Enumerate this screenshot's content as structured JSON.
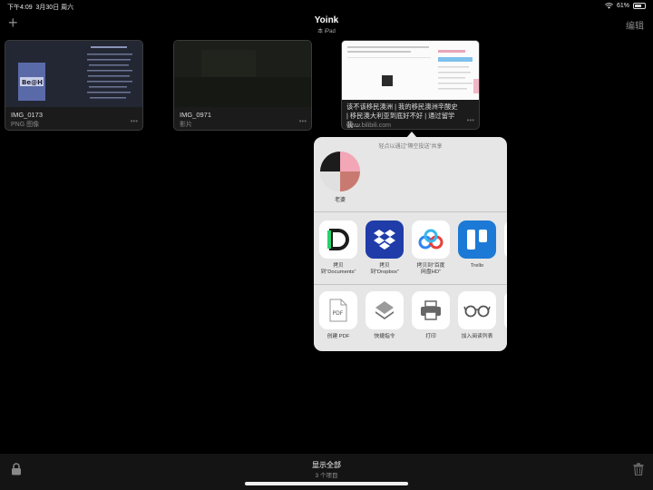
{
  "status_bar": {
    "time": "下午4:09",
    "date": "3月30日 周六",
    "battery": "61%",
    "battery_level": 0.61
  },
  "nav": {
    "title": "Yoink",
    "subtitle": "本 iPad",
    "edit": "编辑"
  },
  "cards": [
    {
      "name": "IMG_0173",
      "kind": "PNG 图像"
    },
    {
      "name": "IMG_0971",
      "kind": "影片"
    },
    {
      "title": "该不该移民澳洲 | 我的移民澳洲辛酸史 | 移民澳大利亚到底好不好 | 通过留学我...",
      "url": "www.bilibili.com"
    }
  ],
  "share": {
    "hint": "轻点以通过“隔空投送”共享",
    "contact": {
      "name": "老婆"
    },
    "apps": [
      {
        "label": "拷贝\n到“Documents”",
        "icon": "documents-icon",
        "color": "#2ad06b"
      },
      {
        "label": "拷贝\n到“Dropbox”",
        "icon": "dropbox-icon",
        "color": "#1f3ca8"
      },
      {
        "label": "拷贝到“百度\n网盘HD”",
        "icon": "baidu-netdisk-icon",
        "color": "#2f84f2"
      },
      {
        "label": "Trello",
        "icon": "trello-icon",
        "color": "#1c7ad6"
      }
    ],
    "actions": [
      {
        "label": "创建 PDF",
        "icon": "pdf-icon"
      },
      {
        "label": "快捷指令",
        "icon": "shortcuts-icon"
      },
      {
        "label": "打印",
        "icon": "printer-icon"
      },
      {
        "label": "加入阅读列表",
        "icon": "glasses-icon"
      }
    ],
    "pdf_badge": "PDF"
  },
  "bottom": {
    "show_all": "显示全部",
    "count": "3 个项目"
  }
}
